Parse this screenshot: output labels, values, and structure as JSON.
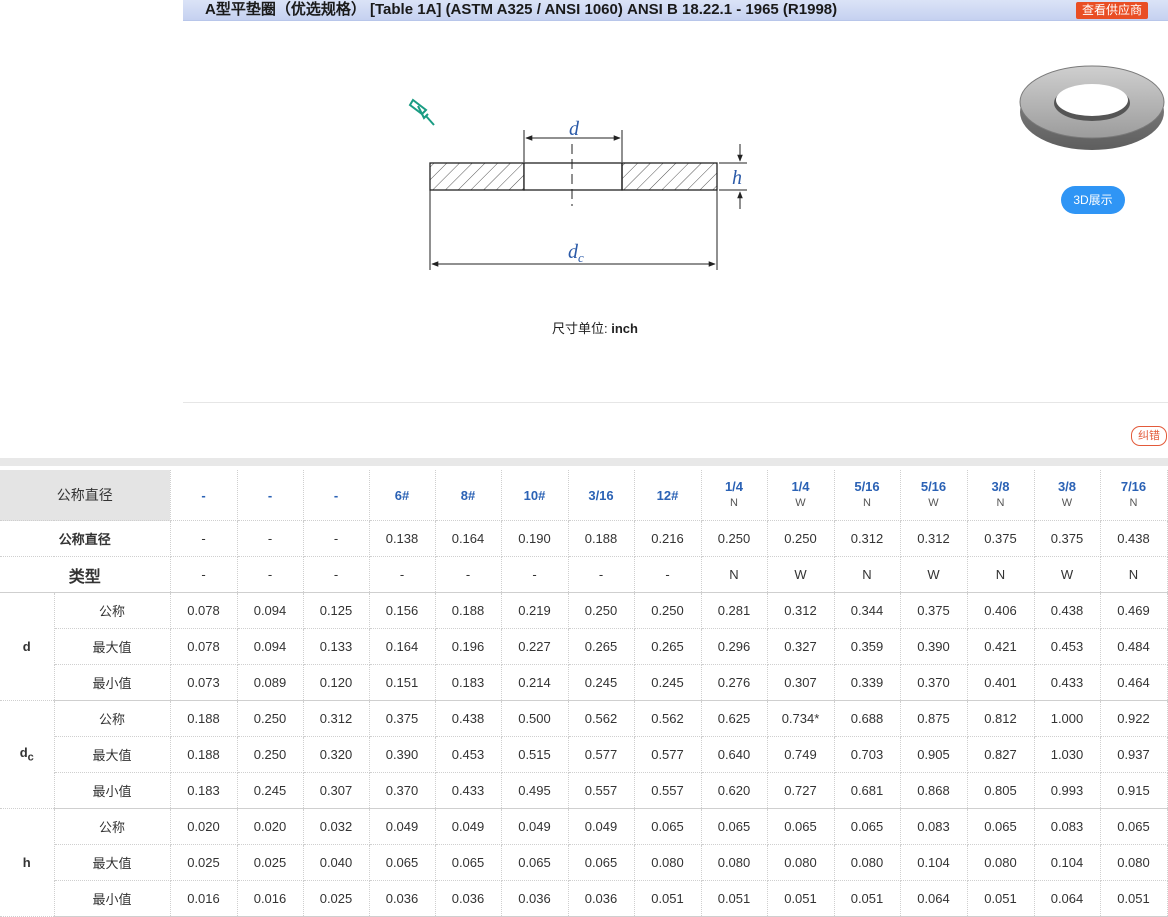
{
  "header": {
    "title": "A型平垫圈（优选规格） [Table 1A] (ASTM A325 / ANSI 1060) ANSI B 18.22.1 - 1965 (R1998)",
    "supplier_button": "查看供应商"
  },
  "diagram": {
    "label_d": "d",
    "label_h": "h",
    "label_dc_main": "d",
    "label_dc_sub": "c"
  },
  "unit": {
    "prefix": "尺寸单位: ",
    "value": "inch"
  },
  "buttons": {
    "view_3d": "3D展示",
    "report_error": "纠错"
  },
  "table": {
    "corner_label": "公称直径",
    "columns": [
      {
        "top": "-",
        "bottom": ""
      },
      {
        "top": "-",
        "bottom": ""
      },
      {
        "top": "-",
        "bottom": ""
      },
      {
        "top": "6#",
        "bottom": ""
      },
      {
        "top": "8#",
        "bottom": ""
      },
      {
        "top": "10#",
        "bottom": ""
      },
      {
        "top": "3/16",
        "bottom": ""
      },
      {
        "top": "12#",
        "bottom": ""
      },
      {
        "top": "1/4",
        "bottom": "N"
      },
      {
        "top": "1/4",
        "bottom": "W"
      },
      {
        "top": "5/16",
        "bottom": "N"
      },
      {
        "top": "5/16",
        "bottom": "W"
      },
      {
        "top": "3/8",
        "bottom": "N"
      },
      {
        "top": "3/8",
        "bottom": "W"
      },
      {
        "top": "7/16",
        "bottom": "N"
      }
    ],
    "rows_simple": [
      {
        "label": "公称直径",
        "values": [
          "-",
          "-",
          "-",
          "0.138",
          "0.164",
          "0.190",
          "0.188",
          "0.216",
          "0.250",
          "0.250",
          "0.312",
          "0.312",
          "0.375",
          "0.375",
          "0.438"
        ]
      },
      {
        "label": "类型",
        "values": [
          "-",
          "-",
          "-",
          "-",
          "-",
          "-",
          "-",
          "-",
          "N",
          "W",
          "N",
          "W",
          "N",
          "W",
          "N"
        ]
      }
    ],
    "groups": [
      {
        "name": "d",
        "name_sub": "",
        "rows": [
          {
            "label": "公称",
            "values": [
              "0.078",
              "0.094",
              "0.125",
              "0.156",
              "0.188",
              "0.219",
              "0.250",
              "0.250",
              "0.281",
              "0.312",
              "0.344",
              "0.375",
              "0.406",
              "0.438",
              "0.469"
            ]
          },
          {
            "label": "最大值",
            "values": [
              "0.078",
              "0.094",
              "0.133",
              "0.164",
              "0.196",
              "0.227",
              "0.265",
              "0.265",
              "0.296",
              "0.327",
              "0.359",
              "0.390",
              "0.421",
              "0.453",
              "0.484"
            ]
          },
          {
            "label": "最小值",
            "values": [
              "0.073",
              "0.089",
              "0.120",
              "0.151",
              "0.183",
              "0.214",
              "0.245",
              "0.245",
              "0.276",
              "0.307",
              "0.339",
              "0.370",
              "0.401",
              "0.433",
              "0.464"
            ]
          }
        ]
      },
      {
        "name": "d",
        "name_sub": "c",
        "rows": [
          {
            "label": "公称",
            "values": [
              "0.188",
              "0.250",
              "0.312",
              "0.375",
              "0.438",
              "0.500",
              "0.562",
              "0.562",
              "0.625",
              "0.734*",
              "0.688",
              "0.875",
              "0.812",
              "1.000",
              "0.922"
            ]
          },
          {
            "label": "最大值",
            "values": [
              "0.188",
              "0.250",
              "0.320",
              "0.390",
              "0.453",
              "0.515",
              "0.577",
              "0.577",
              "0.640",
              "0.749",
              "0.703",
              "0.905",
              "0.827",
              "1.030",
              "0.937"
            ]
          },
          {
            "label": "最小值",
            "values": [
              "0.183",
              "0.245",
              "0.307",
              "0.370",
              "0.433",
              "0.495",
              "0.557",
              "0.557",
              "0.620",
              "0.727",
              "0.681",
              "0.868",
              "0.805",
              "0.993",
              "0.915"
            ]
          }
        ]
      },
      {
        "name": "h",
        "name_sub": "",
        "rows": [
          {
            "label": "公称",
            "values": [
              "0.020",
              "0.020",
              "0.032",
              "0.049",
              "0.049",
              "0.049",
              "0.049",
              "0.065",
              "0.065",
              "0.065",
              "0.065",
              "0.083",
              "0.065",
              "0.083",
              "0.065"
            ]
          },
          {
            "label": "最大值",
            "values": [
              "0.025",
              "0.025",
              "0.040",
              "0.065",
              "0.065",
              "0.065",
              "0.065",
              "0.080",
              "0.080",
              "0.080",
              "0.080",
              "0.104",
              "0.080",
              "0.104",
              "0.080"
            ]
          },
          {
            "label": "最小值",
            "values": [
              "0.016",
              "0.016",
              "0.025",
              "0.036",
              "0.036",
              "0.036",
              "0.036",
              "0.051",
              "0.051",
              "0.051",
              "0.051",
              "0.064",
              "0.051",
              "0.064",
              "0.051"
            ]
          }
        ]
      }
    ]
  }
}
